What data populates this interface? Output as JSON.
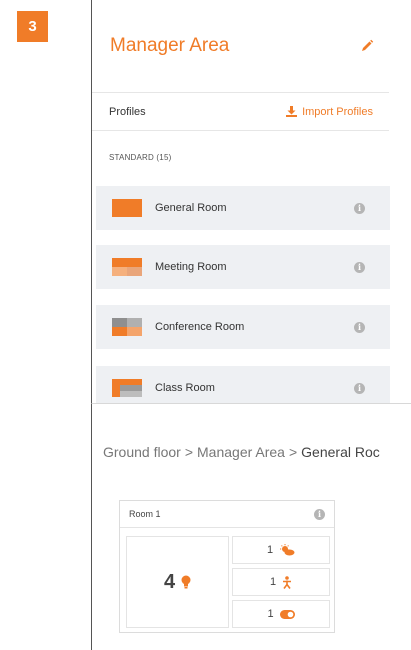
{
  "step": "3",
  "panel": {
    "title": "Manager Area",
    "profiles_label": "Profiles",
    "import_label": "Import Profiles",
    "section_label": "STANDARD (15)",
    "items": [
      {
        "name": "General Room"
      },
      {
        "name": "Meeting Room"
      },
      {
        "name": "Conference Room"
      },
      {
        "name": "Class Room"
      }
    ]
  },
  "breadcrumb": {
    "items": [
      "Ground floor",
      "Manager Area",
      "General Roc"
    ],
    "separator": ">"
  },
  "room": {
    "name": "Room 1",
    "lights": "4",
    "stats": [
      "1",
      "1",
      "1"
    ]
  },
  "colors": {
    "accent": "#f07c28",
    "item_bg": "#eef0f3",
    "thumb_gray": "#9a9a9a"
  }
}
